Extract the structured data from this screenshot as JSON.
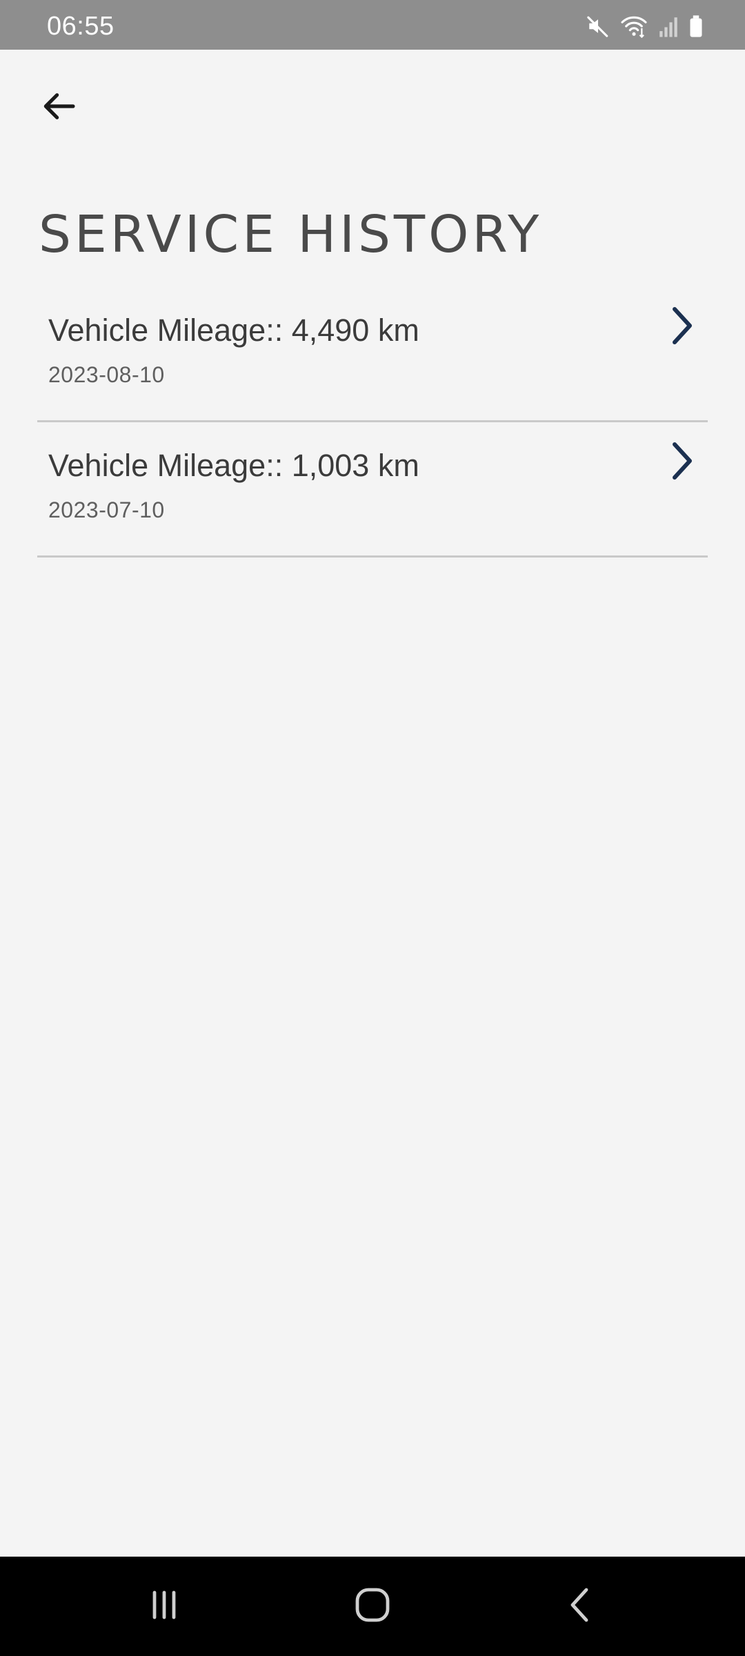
{
  "status_bar": {
    "time": "06:55",
    "icons": [
      "mute-icon",
      "wifi-icon",
      "signal-icon",
      "battery-icon"
    ]
  },
  "header": {
    "back_icon": "arrow-left-icon",
    "title": "SERVICE HISTORY"
  },
  "service_records": [
    {
      "title": "Vehicle Mileage:: 4,490 km",
      "date": "2023-08-10"
    },
    {
      "title": "Vehicle Mileage:: 1,003 km",
      "date": "2023-07-10"
    }
  ],
  "nav_bar": {
    "buttons": [
      "recents-icon",
      "home-icon",
      "back-icon"
    ]
  },
  "colors": {
    "background": "#f4f4f4",
    "status_bar": "#8e8e8e",
    "chevron": "#1b3050",
    "divider": "#c9c9c9",
    "nav_bar": "#000000"
  }
}
